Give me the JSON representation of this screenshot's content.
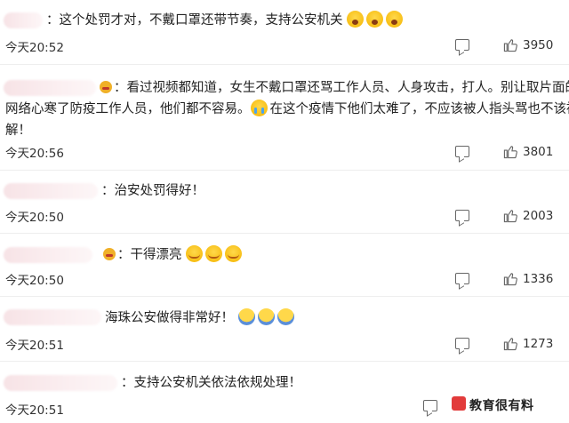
{
  "comments": [
    {
      "text": "：这个处罚才对，不戴口罩还带节奏，支持公安机关",
      "time": "今天20:52",
      "likes": "3950"
    },
    {
      "line1": "看过视频都知道，女生不戴口罩还骂工作人员、人身攻击，打人。别让取片面的",
      "line2": "网络心寒了防疫工作人员，他们都不容易。",
      "line2b": "在这个疫情下他们太难了，不应该被人指头骂也不该被误",
      "line3": "解！",
      "time": "今天20:56",
      "likes": "3801"
    },
    {
      "text": "：治安处罚得好！",
      "time": "今天20:50",
      "likes": "2003"
    },
    {
      "text": "：干得漂亮",
      "time": "今天20:50",
      "likes": "1336"
    },
    {
      "text": "海珠公安做得非常好！",
      "time": "今天20:51",
      "likes": "1273"
    },
    {
      "text": "：支持公安机关依法依规处理！",
      "time": "今天20:51",
      "likes": ""
    }
  ],
  "watermark": "教育很有料",
  "colors": {
    "text": "#222222",
    "blur": "#f7e3e6",
    "icon": "#666666"
  }
}
